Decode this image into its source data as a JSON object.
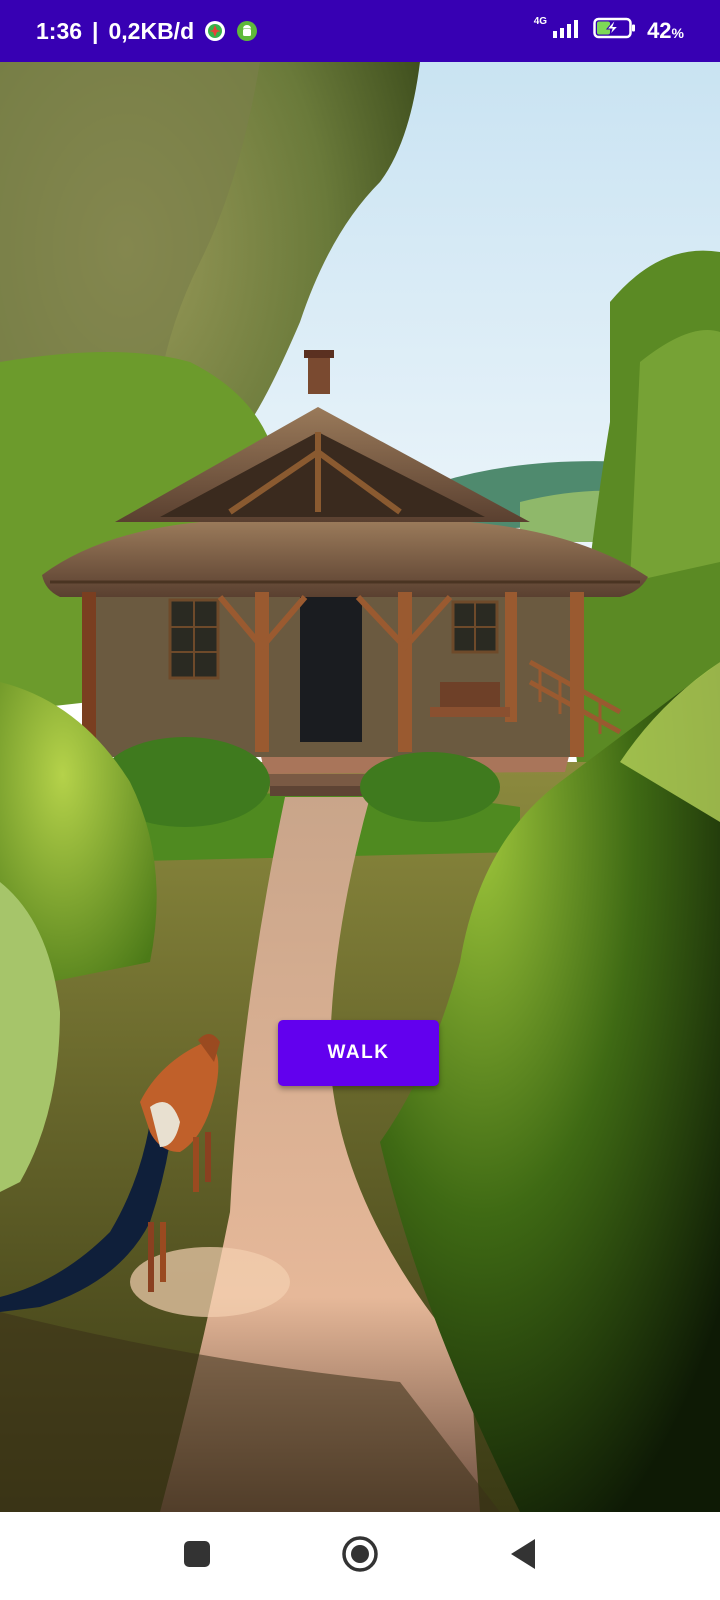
{
  "status_bar": {
    "time": "1:36",
    "separator": "|",
    "data_rate": "0,2KB/d",
    "network_type": "4G",
    "battery_percent": "42",
    "battery_unit": "%",
    "battery_level": 0.42,
    "icons": [
      "app-notification-icon",
      "android-notification-icon",
      "signal-icon",
      "battery-charging-icon"
    ]
  },
  "main": {
    "background": "cottage-with-fox-on-path-illustration",
    "walk_button_label": "WALK"
  },
  "nav_bar": {
    "icons": [
      "recents-icon",
      "home-icon",
      "back-icon"
    ]
  },
  "colors": {
    "status_bar": "#3700b3",
    "button": "#6200ee",
    "nav_icons": "#333333"
  }
}
